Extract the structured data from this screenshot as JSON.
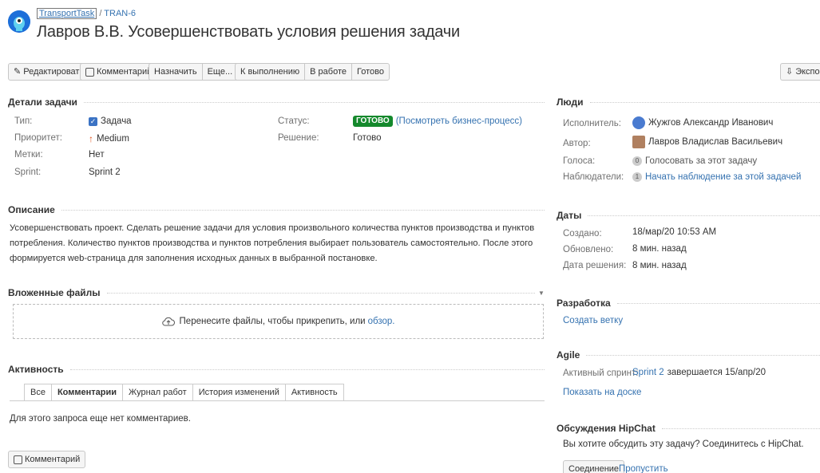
{
  "header": {
    "project": "TransportTask",
    "separator": "/",
    "issue_key": "TRAN-6",
    "title": "Лавров В.В. Усовершенствовать условия решения задачи"
  },
  "toolbar": {
    "edit": "Редактировать",
    "comment": "Комментарий",
    "assign": "Назначить",
    "more": "Еще...",
    "to_do": "К выполнению",
    "in_progress": "В работе",
    "done": "Готово",
    "export": "Экспорт"
  },
  "details": {
    "heading": "Детали задачи",
    "type_label": "Тип:",
    "type_value": "Задача",
    "priority_label": "Приоритет:",
    "priority_value": "Medium",
    "labels_label": "Метки:",
    "labels_value": "Нет",
    "sprint_label": "Sprint:",
    "sprint_value": "Sprint 2",
    "status_label": "Статус:",
    "status_value": "ГОТОВО",
    "workflow_link": "(Посмотреть бизнес-процесс)",
    "resolution_label": "Решение:",
    "resolution_value": "Готово"
  },
  "description": {
    "heading": "Описание",
    "text": "Усовершенствовать проект. Сделать решение задачи для условия произвольного количества  пунктов производства и пунктов потребления. Количество пунктов производства и пунктов потребления выбирает пользователь самостоятельно. После этого формируется web-страница для заполнения исходных данных в выбранной постановке."
  },
  "attachments": {
    "heading": "Вложенные файлы",
    "drop_text": "Перенесите файлы, чтобы прикрепить, или",
    "browse": "обзор."
  },
  "activity": {
    "heading": "Активность",
    "tabs": [
      "Все",
      "Комментарии",
      "Журнал работ",
      "История изменений",
      "Активность"
    ],
    "empty": "Для этого запроса еще нет комментариев.",
    "comment_button": "Комментарий"
  },
  "people": {
    "heading": "Люди",
    "assignee_label": "Исполнитель:",
    "assignee_value": "Жужгов Александр Иванович",
    "reporter_label": "Автор:",
    "reporter_value": "Лавров Владислав Васильевич",
    "votes_label": "Голоса:",
    "votes_count": "0",
    "votes_link": "Голосовать за этот задачу",
    "watchers_label": "Наблюдатели:",
    "watchers_count": "1",
    "watchers_link": "Начать наблюдение за этой задачей"
  },
  "dates": {
    "heading": "Даты",
    "created_label": "Создано:",
    "created_value": "18/мар/20 10:53 AM",
    "updated_label": "Обновлено:",
    "updated_value": "8 мин. назад",
    "resolved_label": "Дата решения:",
    "resolved_value": "8 мин. назад"
  },
  "development": {
    "heading": "Разработка",
    "create_branch": "Создать ветку"
  },
  "agile": {
    "heading": "Agile",
    "sprint_label": "Активный спринт:",
    "sprint_link": "Sprint 2",
    "sprint_suffix": "завершается 15/апр/20",
    "board_link": "Показать на доске"
  },
  "hipchat": {
    "heading": "Обсуждения HipChat",
    "prompt": "Вы хотите обсудить эту задачу? Соединитесь с HipChat.",
    "connect": "Соединение",
    "skip": "Пропустить"
  },
  "colors": {
    "link": "#3572b0",
    "done_lozenge": "#14892c",
    "priority_medium": "#e0531c"
  }
}
